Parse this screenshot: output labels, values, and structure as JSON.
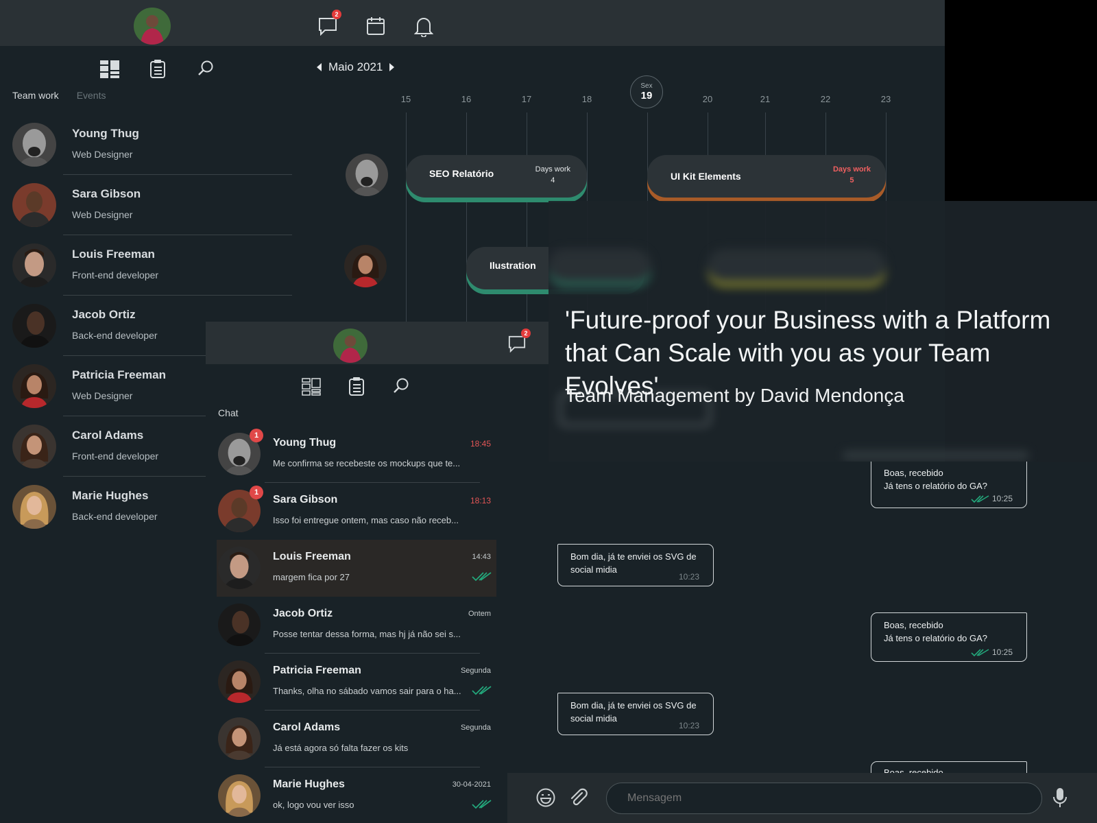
{
  "desktop": {
    "topbar": {
      "messages_badge": "2"
    },
    "tabs": {
      "team_work": "Team work",
      "events": "Events"
    },
    "team": [
      {
        "name": "Young Thug",
        "role": "Web Designer"
      },
      {
        "name": "Sara Gibson",
        "role": "Web Designer"
      },
      {
        "name": "Louis Freeman",
        "role": "Front-end developer"
      },
      {
        "name": "Jacob Ortiz",
        "role": "Back-end developer"
      },
      {
        "name": "Patricia Freeman",
        "role": "Web Designer"
      },
      {
        "name": "Carol Adams",
        "role": "Front-end developer"
      },
      {
        "name": "Marie Hughes",
        "role": "Back-end developer"
      }
    ],
    "calendar": {
      "month": "Maio 2021",
      "days": [
        "15",
        "16",
        "17",
        "18",
        "19",
        "20",
        "21",
        "22",
        "23"
      ],
      "today": {
        "weekday": "Sex",
        "day": "19"
      },
      "tasks": [
        {
          "name": "SEO Relatório",
          "days_label": "Days work",
          "days": "4",
          "color": "#2e8b6e"
        },
        {
          "name": "UI Kit Elements",
          "days_label": "Days work",
          "days": "5",
          "color": "#a85b28",
          "days_color": "#f06060"
        },
        {
          "name": "Ilustration",
          "color": "#2e8b6e"
        }
      ]
    }
  },
  "mobile": {
    "topbar": {
      "messages_badge": "2"
    },
    "section_title": "Chat",
    "chats": [
      {
        "name": "Young Thug",
        "message": "Me confirma se recebeste os mockups que te...",
        "time": "18:45",
        "unread": "1"
      },
      {
        "name": "Sara Gibson",
        "message": "Isso foi entregue ontem, mas caso não receb...",
        "time": "18:13",
        "unread": "1"
      },
      {
        "name": "Louis Freeman",
        "message": "margem fica por 27",
        "time": "14:43",
        "read": true
      },
      {
        "name": "Jacob Ortiz",
        "message": "Posse tentar dessa forma, mas hj já não sei s...",
        "time": "Ontem"
      },
      {
        "name": "Patricia Freeman",
        "message": "Thanks, olha no sábado vamos sair para o ha...",
        "time": "Segunda",
        "read": true
      },
      {
        "name": "Carol Adams",
        "message": "Já está agora só falta fazer os kits",
        "time": "Segunda"
      },
      {
        "name": "Marie Hughes",
        "message": "ok, logo vou ver isso",
        "time": "30-04-2021",
        "read": true
      }
    ]
  },
  "hero": {
    "title": "'Future-proof your Business with a Platform that Can Scale with you as your Team Evolves'",
    "subtitle": "Team Management by David Mendonça"
  },
  "conversation": {
    "messages": [
      {
        "dir": "out",
        "line1": "Boas, recebido",
        "line2": "Já tens o relatório do GA?",
        "time": "10:25"
      },
      {
        "dir": "in",
        "line1": "Bom dia, já te enviei os SVG de",
        "line2": "social midia",
        "time": "10:23"
      },
      {
        "dir": "out",
        "line1": "Boas, recebido",
        "line2": "Já tens o relatório do GA?",
        "time": "10:25"
      },
      {
        "dir": "in",
        "line1": "Bom dia, já te enviei os SVG de",
        "line2": "social midia",
        "time": "10:23"
      },
      {
        "dir": "out",
        "line1": "Boas, recebido",
        "line2": "",
        "time": ""
      }
    ],
    "composer_placeholder": "Mensagem"
  },
  "colors": {
    "accent_green": "#2e8b6e",
    "accent_orange": "#a85b28",
    "unread_red": "#e04848",
    "tick_green": "#23a77b"
  }
}
